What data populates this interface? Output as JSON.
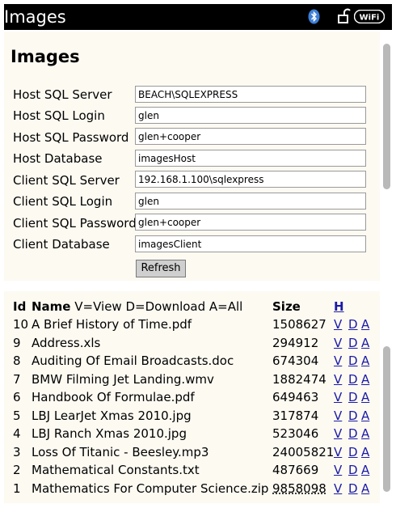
{
  "titlebar": {
    "title": "Images",
    "wifi_label": "WiFi"
  },
  "heading": "Images",
  "form": {
    "fields": [
      {
        "label": "Host SQL Server",
        "value": "BEACH\\SQLEXPRESS"
      },
      {
        "label": "Host SQL Login",
        "value": "glen"
      },
      {
        "label": "Host SQL Password",
        "value": "glen+cooper"
      },
      {
        "label": "Host Database",
        "value": "imagesHost"
      },
      {
        "label": "Client SQL Server",
        "value": "192.168.1.100\\sqlexpress"
      },
      {
        "label": "Client SQL Login",
        "value": "glen"
      },
      {
        "label": "Client SQL Password",
        "value": "glen+cooper"
      },
      {
        "label": "Client Database",
        "value": "imagesClient"
      }
    ],
    "refresh_label": "Refresh"
  },
  "table": {
    "headers": {
      "id": "Id",
      "name": "Name",
      "legend": "V=View D=Download A=All",
      "size": "Size",
      "h": "H"
    },
    "rows": [
      {
        "id": "10",
        "name": "A Brief History of Time.pdf",
        "size": "1508627",
        "v": "V",
        "d": "D",
        "a": "A"
      },
      {
        "id": "9",
        "name": "Address.xls",
        "size": "294912",
        "v": "V",
        "d": "D",
        "a": "A"
      },
      {
        "id": "8",
        "name": "Auditing Of Email Broadcasts.doc",
        "size": "674304",
        "v": "V",
        "d": "D",
        "a": "A"
      },
      {
        "id": "7",
        "name": "BMW Filming Jet Landing.wmv",
        "size": "1882474",
        "v": "V",
        "d": "D",
        "a": "A"
      },
      {
        "id": "6",
        "name": "Handbook Of Formulae.pdf",
        "size": "649463",
        "v": "V",
        "d": "D",
        "a": "A"
      },
      {
        "id": "5",
        "name": "LBJ LearJet Xmas 2010.jpg",
        "size": "317874",
        "v": "V",
        "d": "D",
        "a": "A"
      },
      {
        "id": "4",
        "name": "LBJ Ranch Xmas 2010.jpg",
        "size": "523046",
        "v": "V",
        "d": "D",
        "a": "A"
      },
      {
        "id": "3",
        "name": "Loss Of Titanic - Beesley.mp3",
        "size": "24005821",
        "v": "V",
        "d": "D",
        "a": "A"
      },
      {
        "id": "2",
        "name": "Mathematical Constants.txt",
        "size": "487669",
        "v": "V",
        "d": "D",
        "a": "A"
      },
      {
        "id": "1",
        "name": "Mathematics For Computer Science.zip",
        "size": "9858098",
        "v": "V",
        "d": "D",
        "a": "A"
      }
    ]
  }
}
